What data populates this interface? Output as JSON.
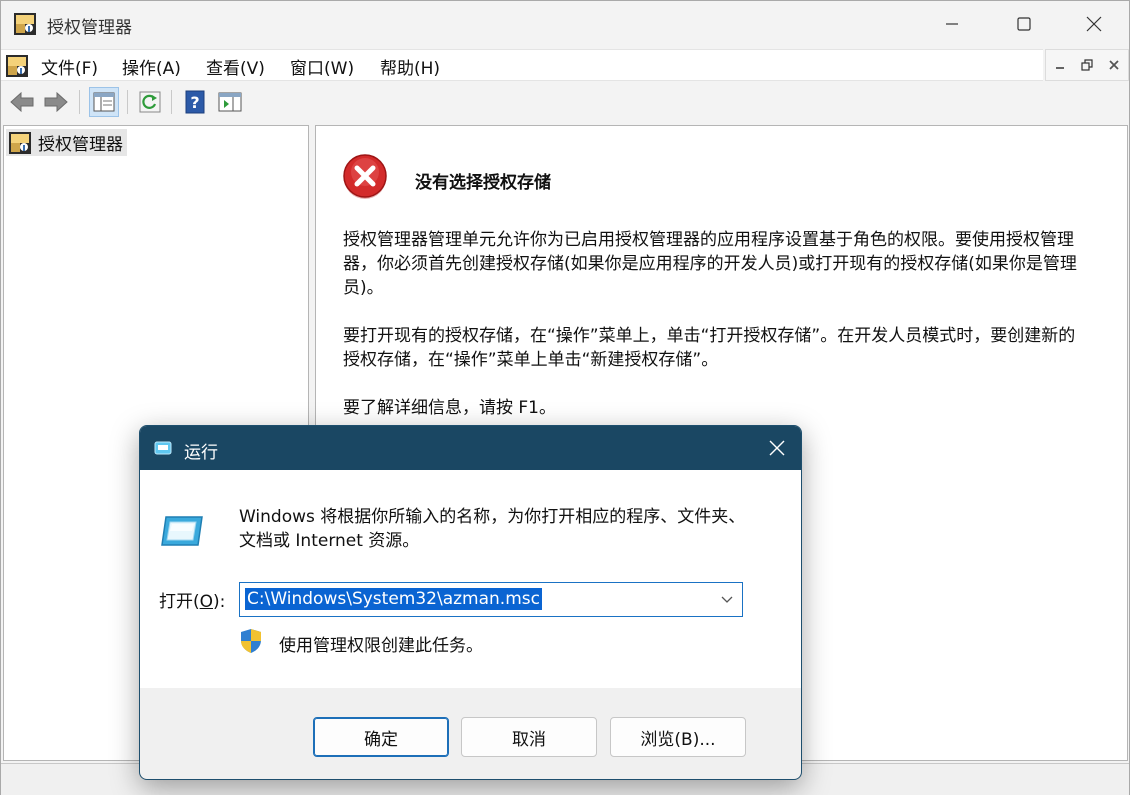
{
  "window": {
    "title": "授权管理器"
  },
  "menu": {
    "items": [
      "文件(F)",
      "操作(A)",
      "查看(V)",
      "窗口(W)",
      "帮助(H)"
    ]
  },
  "toolbar": {
    "icons": [
      "back-arrow-icon",
      "forward-arrow-icon",
      "show-hide-console-tree-icon",
      "refresh-icon",
      "help-icon",
      "action-pane-icon"
    ]
  },
  "tree": {
    "root_label": "授权管理器"
  },
  "content": {
    "heading": "没有选择授权存储",
    "para1": "授权管理器管理单元允许你为已启用授权管理器的应用程序设置基于角色的权限。要使用授权管理器，你必须首先创建授权存储(如果你是应用程序的开发人员)或打开现有的授权存储(如果你是管理员)。",
    "para2": "要打开现有的授权存储，在“操作”菜单上，单击“打开授权存储”。在开发人员模式时，要创建新的授权存储，在“操作”菜单上单击“新建授权存储”。",
    "para3": "要了解详细信息，请按 F1。"
  },
  "run_dialog": {
    "title": "运行",
    "description": "Windows 将根据你所输入的名称，为你打开相应的程序、文件夹、文档或 Internet 资源。",
    "open_label_pre": "打开(",
    "open_label_key": "O",
    "open_label_post": "):",
    "command_value": "C:\\Windows\\System32\\azman.msc",
    "admin_note": "使用管理权限创建此任务。",
    "ok_label": "确定",
    "cancel_label": "取消",
    "browse_label": "浏览(B)..."
  },
  "colors": {
    "dialog_title_bar": "#1a4763",
    "selection": "#0a64d2",
    "error_red": "#d32b2b"
  }
}
